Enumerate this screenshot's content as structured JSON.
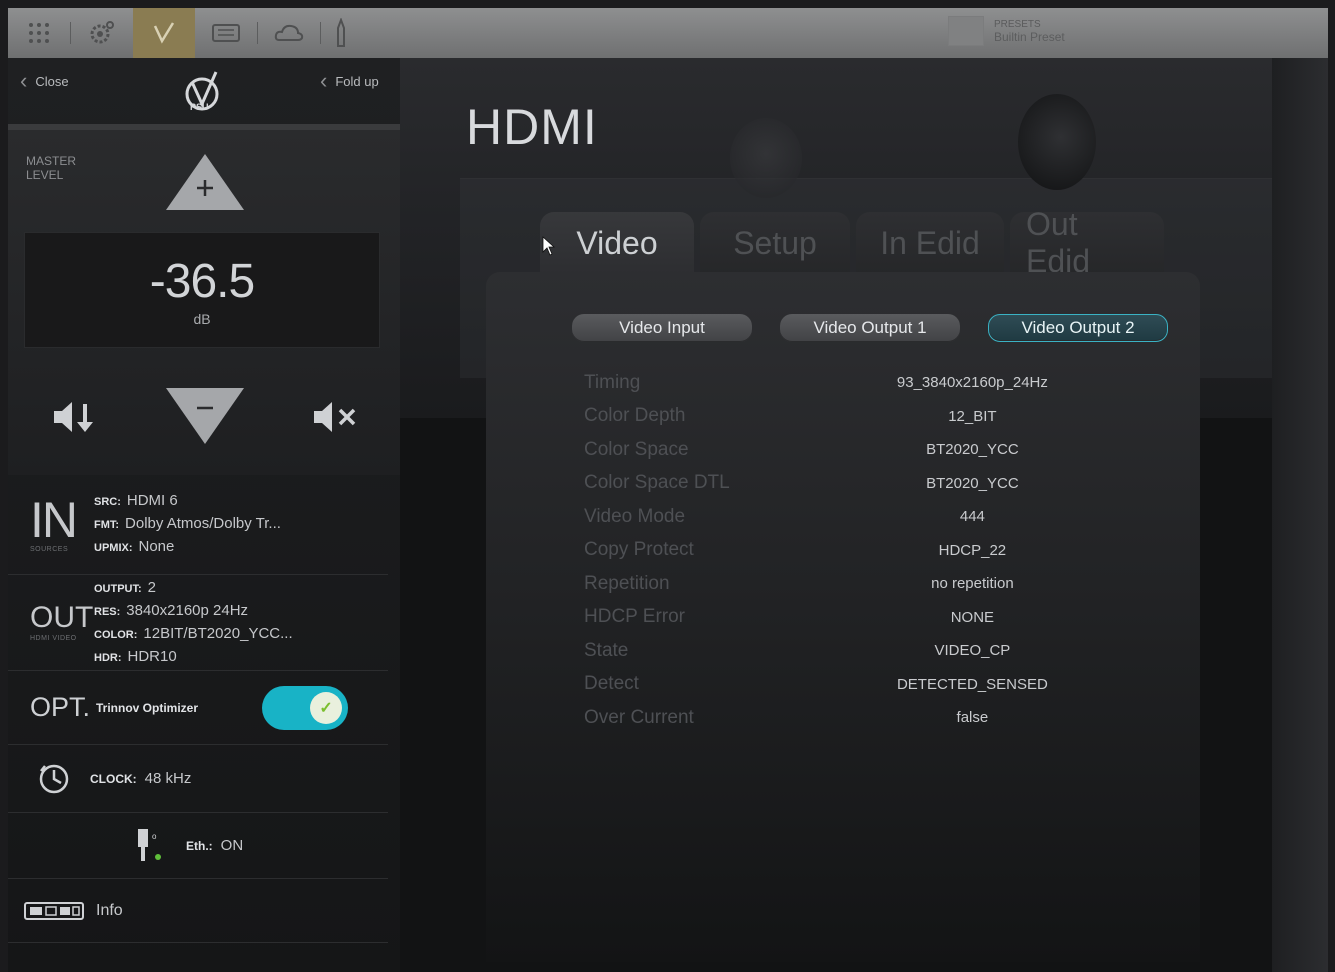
{
  "toolbar": {
    "items": [
      "grid-icon",
      "settings-icon",
      "check-icon",
      "display-icon",
      "cloud-icon",
      "mic-icon"
    ],
    "active_index": 2,
    "preset_label": "PRESETS",
    "preset_name": "Builtin Preset"
  },
  "left_panel": {
    "close_label": "Close",
    "foldup_label": "Fold up",
    "master": {
      "label_line1": "MASTER",
      "label_line2": "LEVEL",
      "value": "-36.5",
      "unit": "dB"
    },
    "input": {
      "big": "IN",
      "sub": "SOURCES",
      "src_key": "SRC:",
      "src_val": "HDMI 6",
      "fmt_key": "FMT:",
      "fmt_val": "Dolby Atmos/Dolby Tr...",
      "upmix_key": "UPMIX:",
      "upmix_val": "None"
    },
    "output": {
      "big": "OUT",
      "sub": "HDMI VIDEO",
      "output_key": "OUTPUT:",
      "output_val": "2",
      "res_key": "RES:",
      "res_val": "3840x2160p 24Hz",
      "color_key": "COLOR:",
      "color_val": "12BIT/BT2020_YCC...",
      "hdr_key": "HDR:",
      "hdr_val": "HDR10"
    },
    "optimizer": {
      "big": "OPT.",
      "label": "Trinnov Optimizer",
      "enabled": true,
      "toggle_color": "#18b3c6"
    },
    "clock": {
      "key": "CLOCK:",
      "val": "48 kHz"
    },
    "eth": {
      "key": "Eth.:",
      "val": "ON"
    },
    "info": {
      "label": "Info"
    }
  },
  "main": {
    "title": "HDMI",
    "tabs": [
      {
        "label": "Video",
        "active": true
      },
      {
        "label": "Setup",
        "active": false
      },
      {
        "label": "In Edid",
        "active": false
      },
      {
        "label": "Out Edid",
        "active": false
      }
    ],
    "subtabs": [
      {
        "label": "Video Input",
        "active": false
      },
      {
        "label": "Video Output 1",
        "active": false
      },
      {
        "label": "Video Output 2",
        "active": true
      }
    ],
    "rows": [
      {
        "key": "Timing",
        "value": "93_3840x2160p_24Hz"
      },
      {
        "key": "Color Depth",
        "value": "12_BIT"
      },
      {
        "key": "Color Space",
        "value": "BT2020_YCC"
      },
      {
        "key": "Color Space DTL",
        "value": "BT2020_YCC"
      },
      {
        "key": "Video Mode",
        "value": "444"
      },
      {
        "key": "Copy Protect",
        "value": "HDCP_22"
      },
      {
        "key": "Repetition",
        "value": "no repetition"
      },
      {
        "key": "HDCP Error",
        "value": "NONE"
      },
      {
        "key": "State",
        "value": "VIDEO_CP"
      },
      {
        "key": "Detect",
        "value": "DETECTED_SENSED"
      },
      {
        "key": "Over Current",
        "value": "false"
      }
    ]
  },
  "colors": {
    "accent": "#18b3c6",
    "toolbar_active": "#8a7c52"
  }
}
